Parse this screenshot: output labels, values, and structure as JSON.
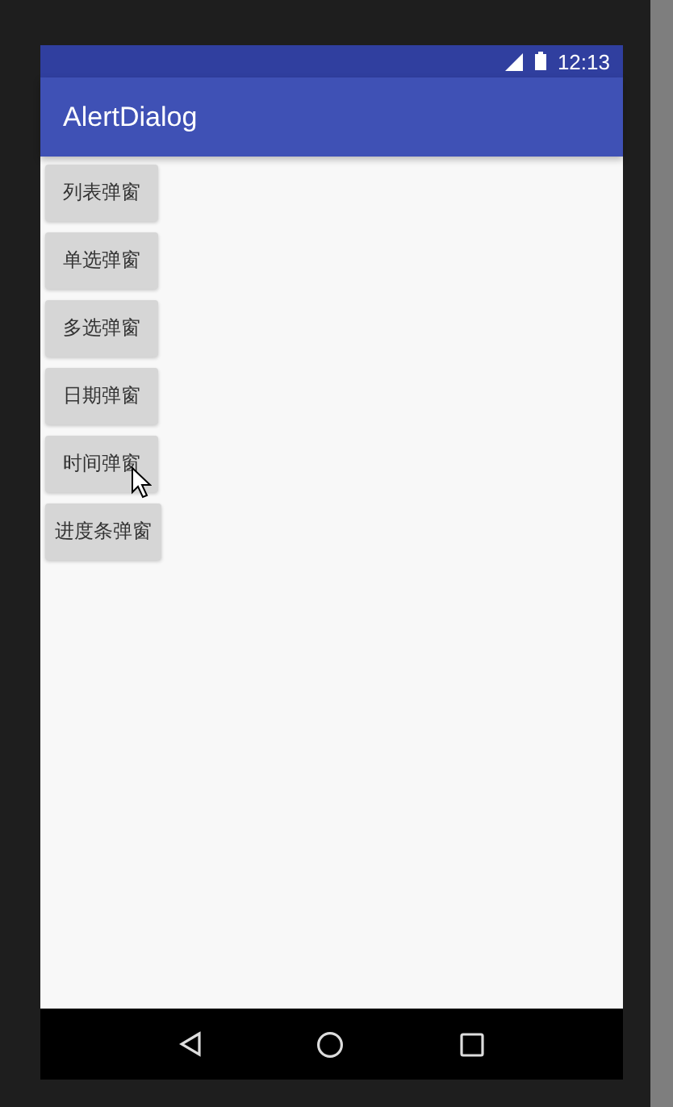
{
  "status_bar": {
    "time": "12:13"
  },
  "app_bar": {
    "title": "AlertDialog"
  },
  "buttons": [
    {
      "label": "列表弹窗"
    },
    {
      "label": "单选弹窗"
    },
    {
      "label": "多选弹窗"
    },
    {
      "label": "日期弹窗"
    },
    {
      "label": "时间弹窗"
    },
    {
      "label": "进度条弹窗"
    }
  ]
}
